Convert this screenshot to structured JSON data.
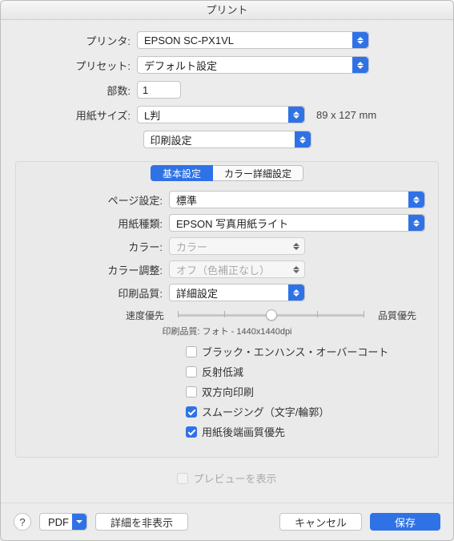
{
  "window": {
    "title": "プリント"
  },
  "upper": {
    "printer_label": "プリンタ:",
    "printer_value": "EPSON SC-PX1VL",
    "preset_label": "プリセット:",
    "preset_value": "デフォルト設定",
    "copies_label": "部数:",
    "copies_value": "1",
    "paper_size_label": "用紙サイズ:",
    "paper_size_value": "L判",
    "paper_size_hint": "89 x 127 mm",
    "section_value": "印刷設定"
  },
  "tabs": {
    "basic": "基本設定",
    "advanced": "カラー詳細設定"
  },
  "settings": {
    "page_setup_label": "ページ設定:",
    "page_setup_value": "標準",
    "media_type_label": "用紙種類:",
    "media_type_value": "EPSON 写真用紙ライト",
    "color_label": "カラー:",
    "color_value": "カラー",
    "color_adjust_label": "カラー調整:",
    "color_adjust_value": "オフ（色補正なし）",
    "print_quality_label": "印刷品質:",
    "print_quality_value": "詳細設定",
    "slider_left": "速度優先",
    "slider_right": "品質優先",
    "quality_hint_label": "印刷品質:",
    "quality_hint_value": "フォト - 1440x1440dpi",
    "chk_black_enhance": "ブラック・エンハンス・オーバーコート",
    "chk_gloss": "反射低減",
    "chk_bidirectional": "双方向印刷",
    "chk_smoothing": "スムージング（文字/輪郭）",
    "chk_finest_detail": "用紙後端画質優先"
  },
  "preview_label": "プレビューを表示",
  "footer": {
    "help": "?",
    "pdf": "PDF",
    "hide_details": "詳細を非表示",
    "cancel": "キャンセル",
    "save": "保存"
  }
}
